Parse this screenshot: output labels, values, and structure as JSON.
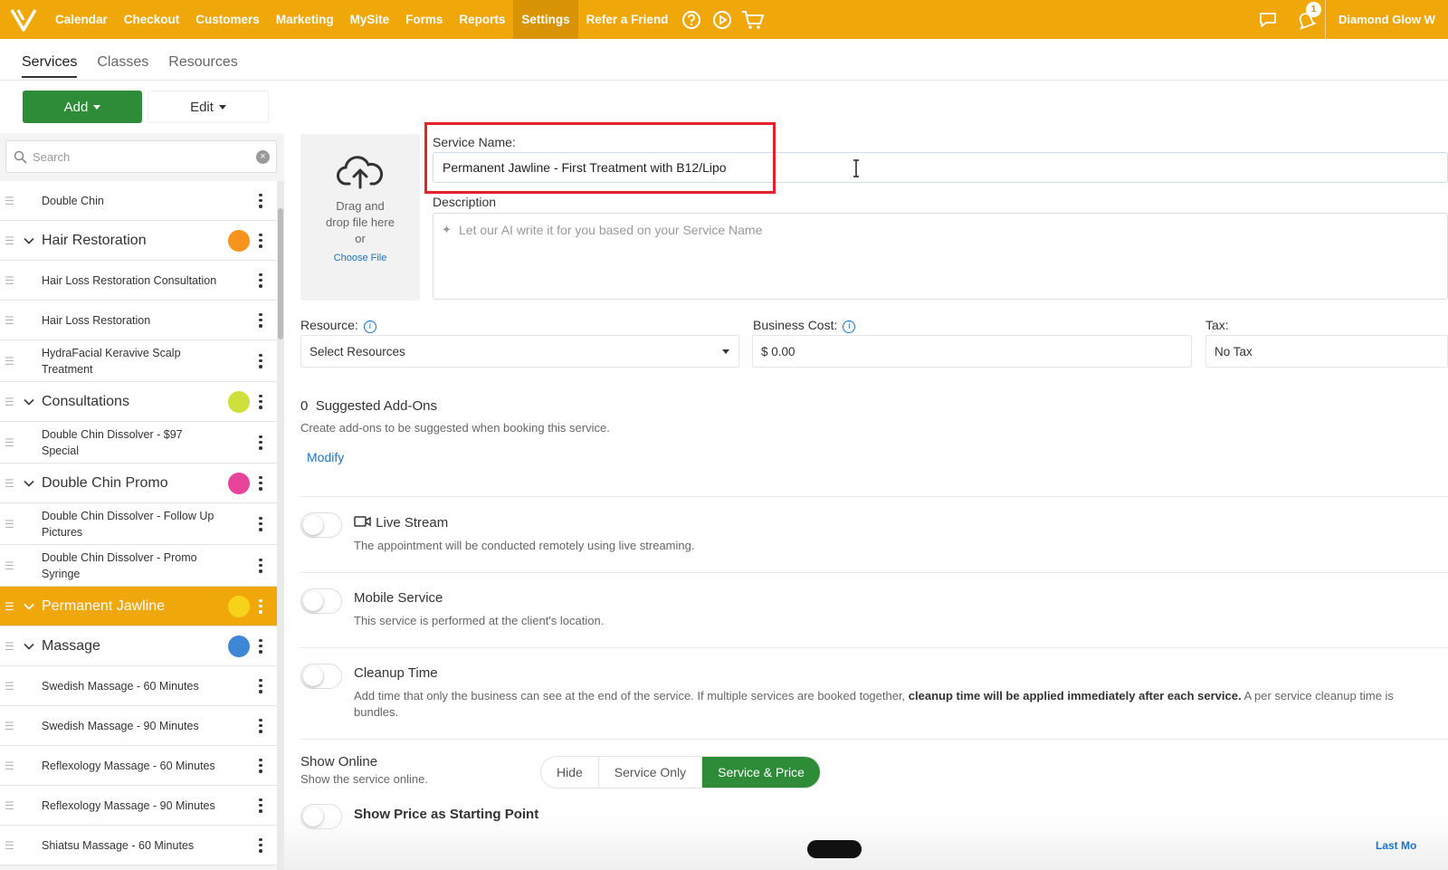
{
  "nav": {
    "items": [
      "Calendar",
      "Checkout",
      "Customers",
      "Marketing",
      "MySite",
      "Forms",
      "Reports",
      "Settings",
      "Refer a Friend"
    ],
    "active": "Settings",
    "notification_count": "1",
    "business_name": "Diamond Glow W",
    "brand_color": "#f0a70a"
  },
  "subtabs": [
    "Services",
    "Classes",
    "Resources"
  ],
  "toolbar": {
    "add_label": "Add",
    "edit_label": "Edit"
  },
  "sidebar": {
    "search_placeholder": "Search",
    "rows": [
      {
        "label": "Double Chin",
        "type": "item"
      },
      {
        "label": "Hair Restoration",
        "type": "group",
        "color": "#f7941d"
      },
      {
        "label": "Hair Loss Restoration Consultation",
        "type": "item"
      },
      {
        "label": "Hair Loss Restoration",
        "type": "item"
      },
      {
        "label": "HydraFacial Keravive Scalp Treatment",
        "type": "item",
        "tall": true
      },
      {
        "label": "Consultations",
        "type": "group",
        "color": "#cde03c"
      },
      {
        "label": "Double Chin Dissolver - $97 Special",
        "type": "item",
        "tall": true
      },
      {
        "label": "Double Chin Promo",
        "type": "group",
        "color": "#e8439a"
      },
      {
        "label": "Double Chin Dissolver - Follow Up Pictures",
        "type": "item",
        "tall": true
      },
      {
        "label": "Double Chin Dissolver - Promo Syringe",
        "type": "item",
        "tall": true
      },
      {
        "label": "Permanent Jawline",
        "type": "group",
        "color": "#f7d21b",
        "selected": true
      },
      {
        "label": "Massage",
        "type": "group",
        "color": "#3e86d6"
      },
      {
        "label": "Swedish Massage - 60 Minutes",
        "type": "item"
      },
      {
        "label": "Swedish Massage - 90 Minutes",
        "type": "item"
      },
      {
        "label": "Reflexology Massage - 60 Minutes",
        "type": "item"
      },
      {
        "label": "Reflexology Massage - 90 Minutes",
        "type": "item"
      },
      {
        "label": "Shiatsu Massage - 60 Minutes",
        "type": "item"
      }
    ]
  },
  "upload": {
    "line1": "Drag and",
    "line2": "drop file here",
    "line3": "or",
    "choose": "Choose File"
  },
  "form": {
    "service_name_label": "Service Name:",
    "service_name_value": "Permanent Jawline - First Treatment with B12/Lipo",
    "description_label": "Description",
    "description_placeholder": "Let our AI write it for you based on your Service Name",
    "resource_label": "Resource:",
    "resource_value": "Select Resources",
    "business_cost_label": "Business Cost:",
    "business_cost_value": "$ 0.00",
    "tax_label": "Tax:",
    "tax_value": "No Tax",
    "addons_count": "0",
    "addons_title": "Suggested Add-Ons",
    "addons_sub": "Create add-ons to be suggested when booking this service.",
    "modify": "Modify",
    "live_title": "Live Stream",
    "live_sub": "The appointment will be conducted remotely using live streaming.",
    "mobile_title": "Mobile Service",
    "mobile_sub": "This service is performed at the client's location.",
    "cleanup_title": "Cleanup Time",
    "cleanup_sub_a": "Add time that only the business can see at the end of the service. If multiple services are booked together, ",
    "cleanup_sub_b": "cleanup time will be applied immediately after each service.",
    "cleanup_sub_c": " A per service cleanup time is",
    "cleanup_sub_d": "bundles.",
    "show_online_title": "Show Online",
    "show_online_sub": "Show the service online.",
    "show_online_options": [
      "Hide",
      "Service Only",
      "Service & Price"
    ],
    "show_online_selected": "Service & Price",
    "start_price_title": "Show Price as Starting Point",
    "last_modified": "Last Mo"
  }
}
